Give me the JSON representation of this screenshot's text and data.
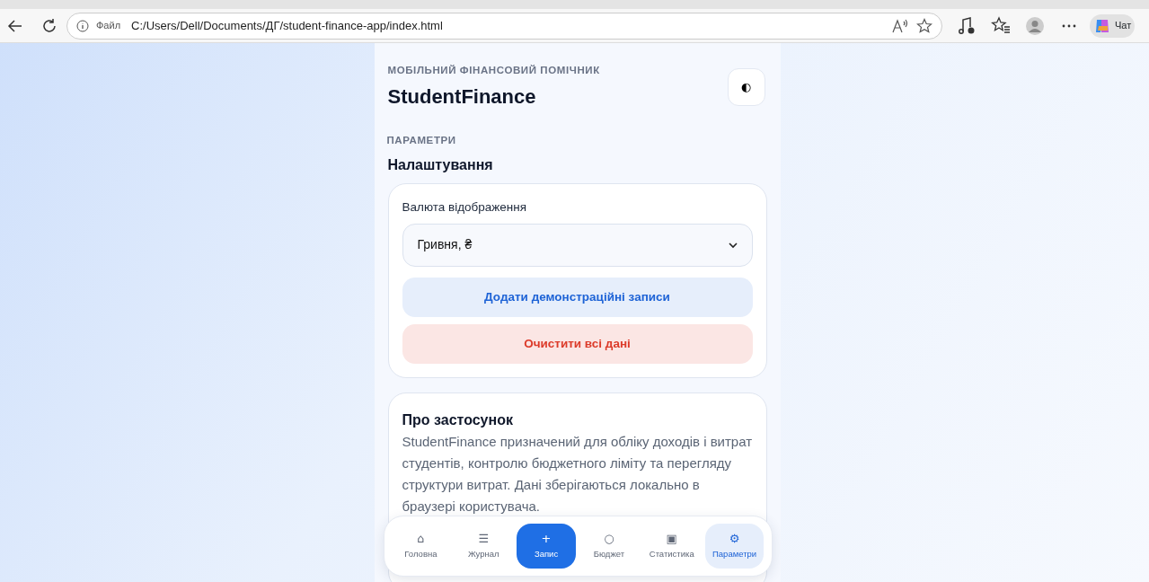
{
  "browser": {
    "file_label": "Файл",
    "url": "C:/Users/Dell/Documents/ДГ/student-finance-app/index.html",
    "chat_label": "Чат"
  },
  "app": {
    "eyebrow": "МОБІЛЬНИЙ ФІНАНСОВИЙ ПОМІЧНИК",
    "title": "StudentFinance",
    "theme_toggle": "◐"
  },
  "section": {
    "eyebrow": "ПАРАМЕТРИ",
    "title": "Налаштування"
  },
  "settings": {
    "currency_label": "Валюта відображення",
    "currency_value": "Гривня, ₴",
    "buttons": [
      {
        "label": "Додати демонстраційні записи",
        "kind": "primary"
      },
      {
        "label": "Очистити всі дані",
        "kind": "danger"
      }
    ]
  },
  "about": {
    "title": "Про застосунок",
    "text": "StudentFinance призначений для обліку доходів і витрат студентів, контролю бюджетного ліміту та перегляду структури витрат. Дані зберігаються локально в браузері користувача."
  },
  "nav": [
    {
      "icon": "⌂",
      "label": "Головна",
      "kind": "tab",
      "selected": false
    },
    {
      "icon": "☰",
      "label": "Журнал",
      "kind": "tab",
      "selected": false
    },
    {
      "icon": "+",
      "label": "Запис",
      "kind": "action",
      "selected": false
    },
    {
      "icon": "○",
      "label": "Бюджет",
      "kind": "tab",
      "selected": false
    },
    {
      "icon": "▣",
      "label": "Статистика",
      "kind": "tab",
      "selected": false
    },
    {
      "icon": "⚙",
      "label": "Параметри",
      "kind": "tab",
      "selected": true
    }
  ]
}
